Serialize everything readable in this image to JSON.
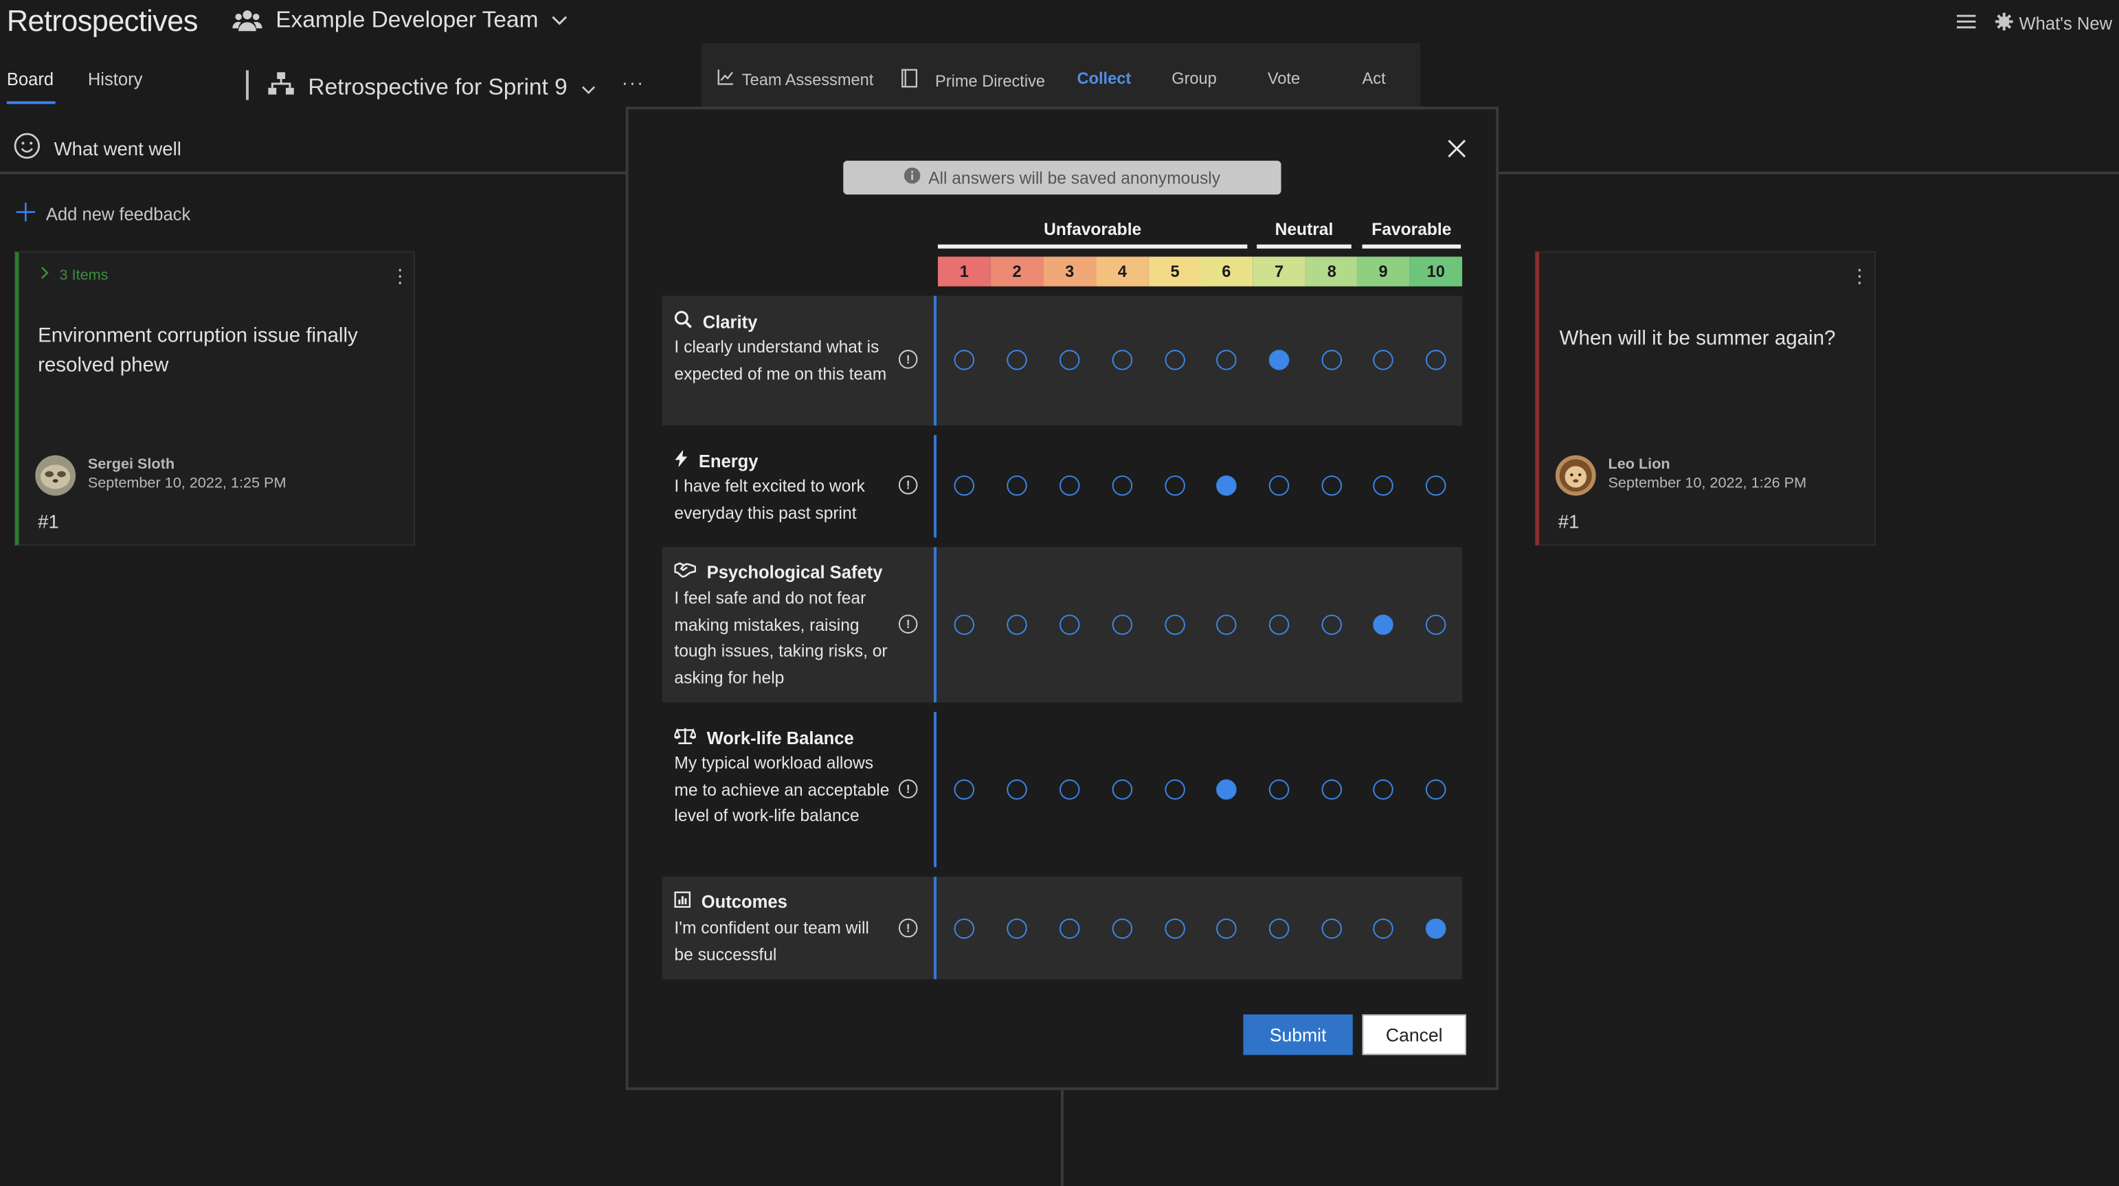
{
  "app": {
    "title": "Retrospectives"
  },
  "team": {
    "name": "Example Developer Team"
  },
  "top_right": {
    "whats_new": "What's New"
  },
  "nav": {
    "tabs": [
      "Board",
      "History"
    ],
    "active": "Board"
  },
  "retro": {
    "name": "Retrospective for Sprint 9",
    "more": "···"
  },
  "phases": [
    "Team Assessment",
    "Prime Directive",
    "Collect",
    "Group",
    "Vote",
    "Act"
  ],
  "active_phase": "Collect",
  "column": {
    "title": "What went well",
    "add_feedback": "Add new feedback"
  },
  "cards": [
    {
      "items_label": "3 Items",
      "text": "Environment corruption issue finally resolved phew",
      "author": "Sergei Sloth",
      "date": "September 10, 2022, 1:25 PM",
      "number": "#1",
      "accent": "#2f7a2f"
    },
    {
      "items_label": "",
      "text": "When will it be summer again?",
      "author": "Leo Lion",
      "date": "September 10, 2022, 1:26 PM",
      "number": "#1",
      "accent": "#8b2d2d"
    }
  ],
  "dialog": {
    "anonymous_note": "All answers will be saved anonymously",
    "scale_groups": [
      "Unfavorable",
      "Neutral",
      "Favorable"
    ],
    "scale": [
      "1",
      "2",
      "3",
      "4",
      "5",
      "6",
      "7",
      "8",
      "9",
      "10"
    ],
    "scale_colors": [
      "#e8706e",
      "#ec8a73",
      "#f0a878",
      "#f3c17e",
      "#f3da86",
      "#e9e18a",
      "#cfe08e",
      "#b3d98b",
      "#8fcf82",
      "#6ec57a"
    ],
    "questions": [
      {
        "title": "Clarity",
        "icon": "search-icon",
        "description": "I clearly understand what is expected of me on this team",
        "selected": 7
      },
      {
        "title": "Energy",
        "icon": "lightning-icon",
        "description": "I have felt excited to work everyday this past sprint",
        "selected": 6
      },
      {
        "title": "Psychological Safety",
        "icon": "handshake-icon",
        "description": "I feel safe and do not fear making mistakes, raising tough issues, taking risks, or asking for help",
        "selected": 9
      },
      {
        "title": "Work-life Balance",
        "icon": "balance-scale-icon",
        "description": "My typical workload allows me to achieve an acceptable level of work-life balance",
        "selected": 6
      },
      {
        "title": "Outcomes",
        "icon": "bar-chart-icon",
        "description": "I'm confident our team will be successful",
        "selected": 10
      }
    ],
    "submit_label": "Submit",
    "cancel_label": "Cancel"
  }
}
